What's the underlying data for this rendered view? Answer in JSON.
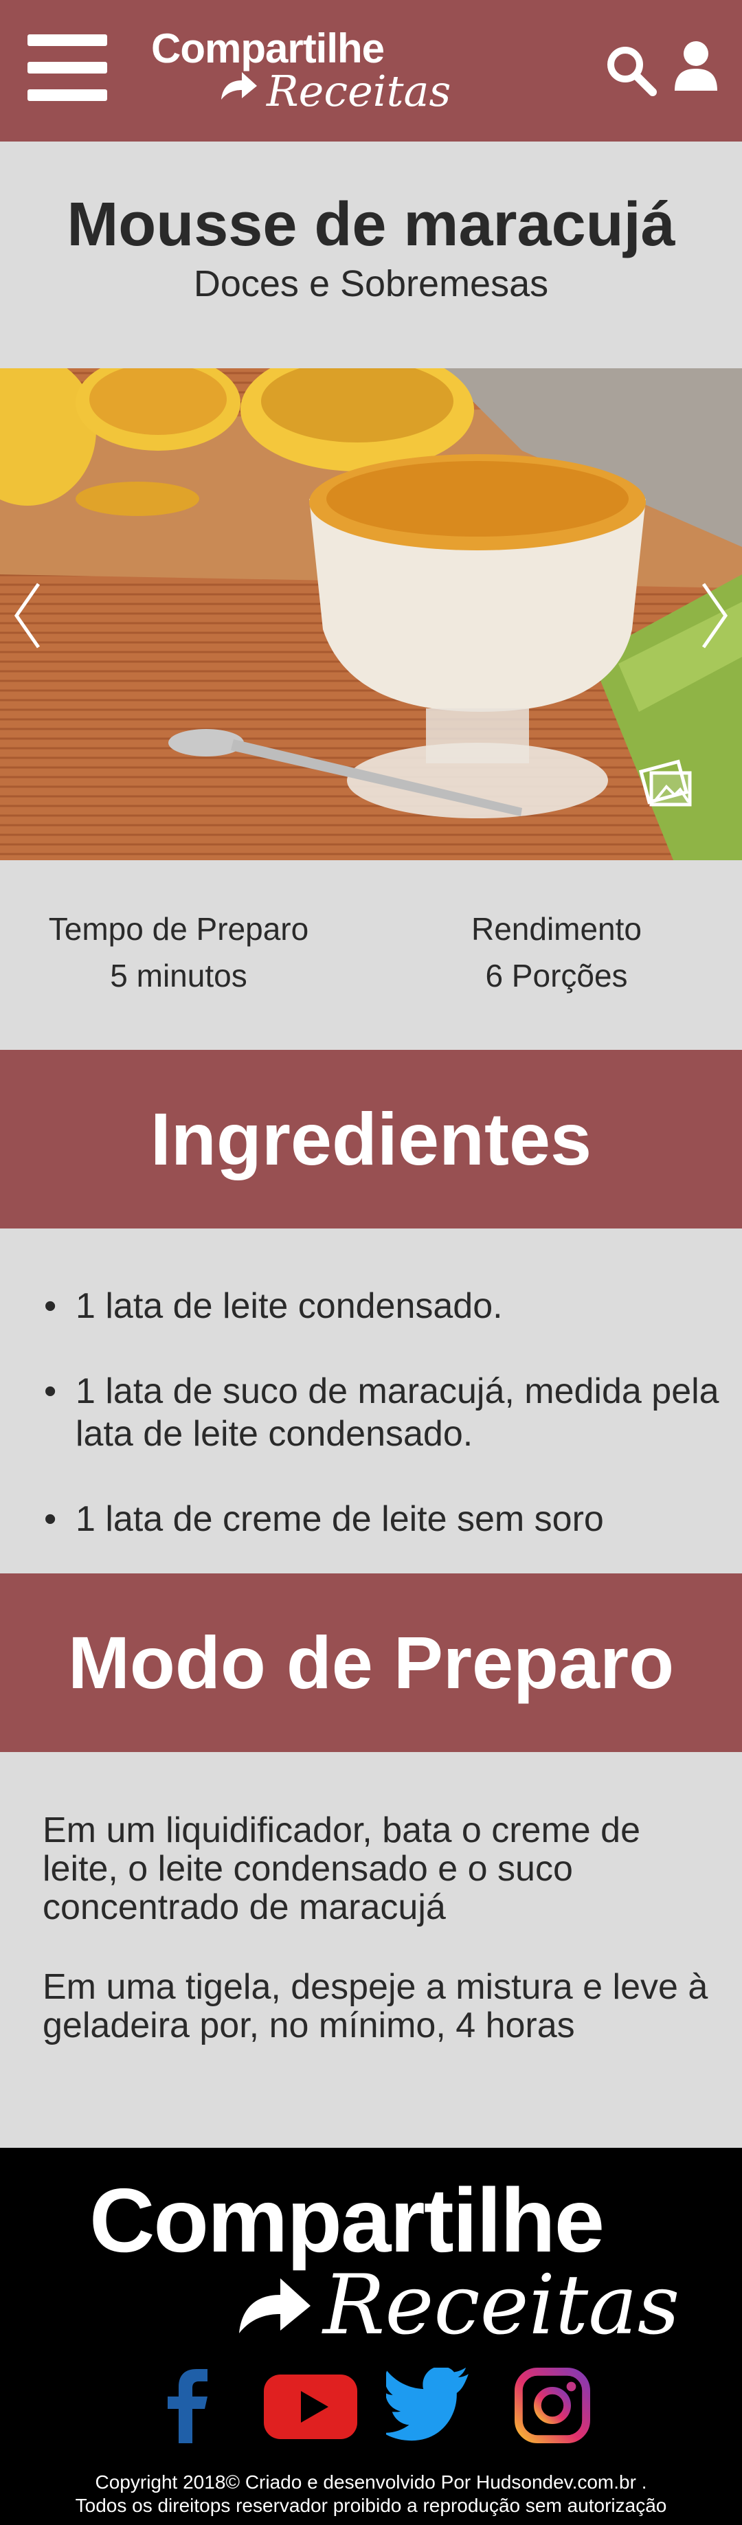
{
  "header": {
    "menu_icon": "hamburger-menu-icon",
    "brand_line1": "Compartilhe",
    "brand_line2": "Receitas",
    "search_icon": "search-icon",
    "user_icon": "user-icon",
    "background_color": "#985052"
  },
  "recipe": {
    "title": "Mousse de maracujá",
    "category": "Doces e Sobremesas"
  },
  "carousel": {
    "prev_icon": "chevron-left-icon",
    "next_icon": "chevron-right-icon",
    "gallery_icon": "gallery-icon"
  },
  "info": {
    "prep_label": "Tempo de Preparo",
    "prep_value": "5 minutos",
    "yield_label": "Rendimento",
    "yield_value": "6 Porções"
  },
  "ingredients": {
    "heading": "Ingredientes",
    "bullet": "•",
    "items": [
      "1 lata de leite condensado.",
      "1 lata de suco de maracujá, medida pela lata de leite condensado.",
      "1 lata de creme de leite sem soro"
    ]
  },
  "preparation": {
    "heading": "Modo de Preparo",
    "steps": [
      "Em um liquidificador, bata o creme de leite, o leite condensado e o suco concentrado de maracujá",
      "Em uma tigela, despeje a mistura e leve à geladeira por, no mínimo, 4 horas"
    ]
  },
  "footer": {
    "brand_line1": "Compartilhe",
    "brand_line2": "Receitas",
    "social": [
      "facebook-icon",
      "youtube-icon",
      "twitter-icon",
      "instagram-icon"
    ],
    "copyright_line1": "Copyright 2018© Criado e desenvolvido Por Hudsondev.com.br  .",
    "copyright_line2": "Todos os direitops reservador proibido a reprodução sem autorização"
  },
  "colors": {
    "accent": "#985052",
    "page_bg": "#dcdcdc",
    "footer_bg": "#000000"
  }
}
